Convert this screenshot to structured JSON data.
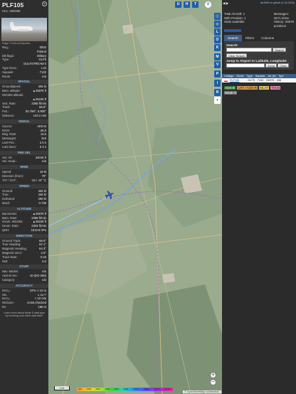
{
  "info": {
    "callsign": "PLF105",
    "hex_label": "Hex: 48D968",
    "close_icon": "close-icon",
    "image_credit": "Image © Andrzej Rękawski",
    "rows_top": [
      {
        "k": "Reg.:",
        "v": "0002"
      },
      {
        "k": "",
        "v": "Poland"
      },
      {
        "k": "DB flags:",
        "v": "military"
      },
      {
        "k": "Type:",
        "v": "GLF5"
      },
      {
        "k": "",
        "v": "GULFSTREAM 5"
      },
      {
        "k": "Type Desc.:",
        "v": "L2J"
      },
      {
        "k": "Squawk:",
        "v": "7132"
      },
      {
        "k": "Route:",
        "v": "n/a"
      }
    ],
    "spatial_title": "SPATIAL",
    "spatial": [
      {
        "k": "Groundspeed:",
        "v": "406 kt"
      },
      {
        "k": "Baro. altitude:",
        "v": "▲25975 ft"
      },
      {
        "k": "WGS84 altitude:",
        "v": ""
      },
      {
        "k": "",
        "v": "▲26225 ft"
      },
      {
        "k": "Vert. Rate:",
        "v": "2368 ft/min"
      },
      {
        "k": "Track:",
        "v": "66.6°"
      },
      {
        "k": "Pos.:",
        "v": "50.796°, 5.900°"
      },
      {
        "k": "Distance:",
        "v": "143.1 nmi"
      }
    ],
    "signal_title": "SIGNAL",
    "signal": [
      {
        "k": "Source:",
        "v": "ADS-B"
      },
      {
        "k": "RSSI:",
        "v": "-25.5"
      },
      {
        "k": "Msg. Rate:",
        "v": "13.5"
      },
      {
        "k": "Messages:",
        "v": "319"
      },
      {
        "k": "Last Pos.:",
        "v": "2.0 s"
      },
      {
        "k": "Last Seen:",
        "v": "0.4 s"
      }
    ],
    "fms_title": "FMS SEL",
    "fms": [
      {
        "k": "Sel. Alt.:",
        "v": "34016 ft"
      },
      {
        "k": "Sel. Head.:",
        "v": "n/a"
      }
    ],
    "wind_title": "WIND",
    "wind": [
      {
        "k": "Speed:",
        "v": "19 kt"
      },
      {
        "k": "Direction (from):",
        "v": "79°"
      },
      {
        "k": "TAT / OAT:",
        "v": "-13 / -37 °C"
      }
    ],
    "speed_title": "SPEED",
    "speed": [
      {
        "k": "Ground:",
        "v": "406 kt"
      },
      {
        "k": "True:",
        "v": "426 kt"
      },
      {
        "k": "Indicated:",
        "v": "298 kt"
      },
      {
        "k": "Mach:",
        "v": "0.728"
      }
    ],
    "altitude_title": "ALTITUDE",
    "altitude": [
      {
        "k": "Barometric:",
        "v": "▲25975 ft"
      },
      {
        "k": "Baro. Rate:",
        "v": "2368 ft/min"
      },
      {
        "k": "Geom. WGS84:",
        "v": "▲26225 ft"
      },
      {
        "k": "Geom. Rate:",
        "v": "2304 ft/min"
      },
      {
        "k": "QNH:",
        "v": "1013.6 hPa"
      }
    ],
    "direction_title": "DIRECTION",
    "direction": [
      {
        "k": "Ground Track:",
        "v": "66.6°"
      },
      {
        "k": "True Heading:",
        "v": "67.1°"
      },
      {
        "k": "Magnetic Heading:",
        "v": "64.3°"
      },
      {
        "k": "Magnetic Decl.:",
        "v": "2.9°"
      },
      {
        "k": "Track Rate:",
        "v": "0.03"
      },
      {
        "k": "Roll:",
        "v": "0.0"
      }
    ],
    "stuff_title": "STUFF",
    "stuff": [
      {
        "k": "Nav. Modes:",
        "v": "n/a"
      },
      {
        "k": "ADS-B Ver.:",
        "v": "v0 (DO-260)"
      },
      {
        "k": "Category:",
        "v": "n/a"
      }
    ],
    "accuracy_title": "ACCURACY",
    "accuracy": [
      {
        "k": "NACₚ:",
        "v": "EPU < 10 m"
      },
      {
        "k": "SIL:",
        "v": "≤ 1e-7"
      },
      {
        "k": "NACᵥ:",
        "v": "< 10 m/s"
      },
      {
        "k": "NICbaro:",
        "v": "cross-checked"
      },
      {
        "k": "Rc:",
        "v": "186 m"
      }
    ],
    "footer": "Learn more about Mode S data type by hovering over each data label."
  },
  "map": {
    "top_buttons": [
      "U",
      "H",
      "T"
    ],
    "side_buttons": [
      "L",
      "O",
      "K",
      "M",
      "V",
      "P",
      "I",
      "R"
    ],
    "scale_label": "2 mi",
    "altitude_bar_labels": [
      "500",
      "1000",
      "2000",
      "4000",
      "6000",
      "8000",
      "10000",
      "20000",
      "30000",
      "40000+"
    ],
    "attribution": "© OpenStreetMap contributors.",
    "zoom_in": "+",
    "zoom_out": "−"
  },
  "right": {
    "top_link": "tar1090 on github (3 Jul 2024)",
    "arrows": "◀ ▶",
    "total_aircraft": "Total Aircraft: 1",
    "with_position": "With Position: 1",
    "stats_label": "Stats available",
    "messages": "Messages:",
    "messages_rate": "1571.2/sec",
    "history": "History: 26679",
    "history_unit": "positions",
    "tabs": [
      "Search",
      "Filters",
      "Columns"
    ],
    "search_label": "Search:",
    "search_button": "Search",
    "clear_search": "Clear Search",
    "jump_label": "Jump to Airport or Latitude, Longitude:",
    "jump_button": "Jump",
    "clear_button": "Clear",
    "columns": [
      "Callsign",
      "Route",
      "Type",
      "Squawk",
      "Alt. (ft)",
      "Spd"
    ],
    "row": {
      "callsign": "PLF105",
      "type": "GLF5",
      "squawk": "7132",
      "alt": "25975",
      "spd": "406"
    },
    "sources": [
      "ADS-B",
      "UAT / ADS-R",
      "MLAT",
      "TIS-B",
      "Mode-S"
    ]
  }
}
